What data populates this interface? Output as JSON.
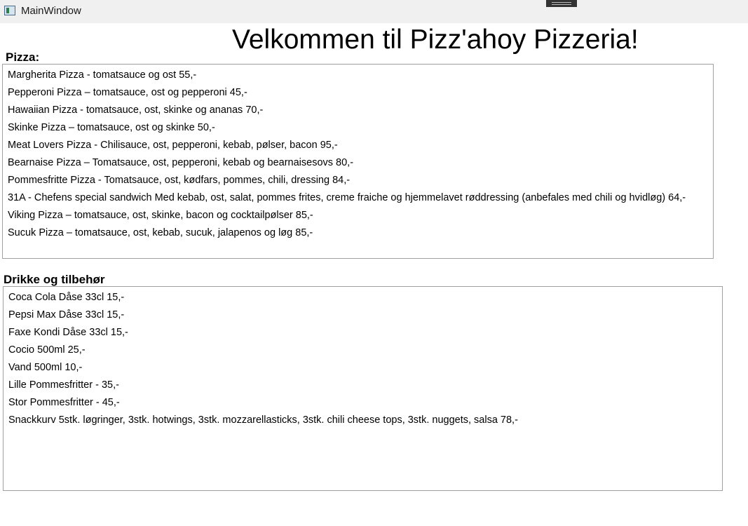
{
  "window": {
    "title": "MainWindow"
  },
  "header": {
    "welcome": "Velkommen til Pizz'ahoy Pizzeria!"
  },
  "pizza": {
    "label": "Pizza:",
    "items": [
      "Margherita Pizza - tomatsauce og ost 55,-",
      "Pepperoni Pizza – tomatsauce, ost og pepperoni 45,-",
      "Hawaiian Pizza - tomatsauce, ost, skinke og ananas 70,-",
      "Skinke Pizza – tomatsauce, ost og skinke 50,-",
      "Meat Lovers Pizza - Chilisauce, ost, pepperoni, kebab, pølser, bacon 95,-",
      "Bearnaise Pizza – Tomatsauce, ost, pepperoni, kebab og bearnaisesovs 80,-",
      "Pommesfritte Pizza - Tomatsauce, ost, kødfars, pommes, chili, dressing 84,-",
      "31A - Chefens special sandwich Med kebab, ost, salat, pommes frites, creme fraiche og hjemmelavet røddressing (anbefales med chili og hvidløg) 64,-",
      "Viking Pizza – tomatsauce, ost, skinke, bacon og cocktailpølser 85,-",
      "Sucuk Pizza – tomatsauce, ost, kebab, sucuk, jalapenos og løg 85,-"
    ]
  },
  "drinks": {
    "label": "Drikke og tilbehør",
    "items": [
      "Coca Cola Dåse 33cl 15,-",
      "Pepsi Max Dåse 33cl 15,-",
      "Faxe Kondi Dåse 33cl 15,-",
      "Cocio 500ml 25,-",
      "Vand 500ml 10,-",
      "Lille Pommesfritter - 35,-",
      "Stor Pommesfritter - 45,-",
      "Snackkurv 5stk. løgringer, 3stk. hotwings, 3stk. mozzarellasticks, 3stk. chili cheese tops, 3stk. nuggets, salsa 78,-"
    ]
  }
}
